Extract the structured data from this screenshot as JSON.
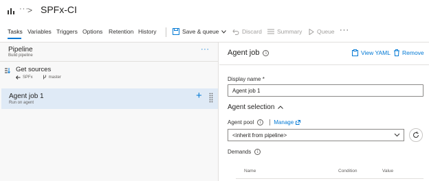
{
  "header": {
    "more": "···",
    "breadcrumb_sep": ">",
    "title": "SPFx-CI"
  },
  "tabs": [
    {
      "label": "Tasks",
      "active": true
    },
    {
      "label": "Variables"
    },
    {
      "label": "Triggers"
    },
    {
      "label": "Options"
    },
    {
      "label": "Retention"
    },
    {
      "label": "History"
    }
  ],
  "toolbar": {
    "save_queue": "Save & queue",
    "discard": "Discard",
    "summary": "Summary",
    "queue": "Queue",
    "more": "···"
  },
  "left": {
    "pipeline_title": "Pipeline",
    "pipeline_sub": "Build pipeline",
    "more": "···",
    "get_sources": {
      "title": "Get sources",
      "repo": "SPFx",
      "branch": "master"
    },
    "agent_job": {
      "title": "Agent job 1",
      "sub": "Run on agent",
      "add": "+"
    }
  },
  "right": {
    "title": "Agent job",
    "view_yaml": "View YAML",
    "remove": "Remove",
    "display_name_label": "Display name *",
    "display_name_value": "Agent job 1",
    "agent_selection": "Agent selection",
    "agent_pool_label": "Agent pool",
    "manage": "Manage",
    "agent_pool_value": "<inherit from pipeline>",
    "demands_label": "Demands",
    "columns": [
      "Name",
      "Condition",
      "Value"
    ]
  },
  "colors": {
    "accent": "#0078d4",
    "selected_bg": "#dfeaf6",
    "panel_bg": "#f8f8f8"
  }
}
